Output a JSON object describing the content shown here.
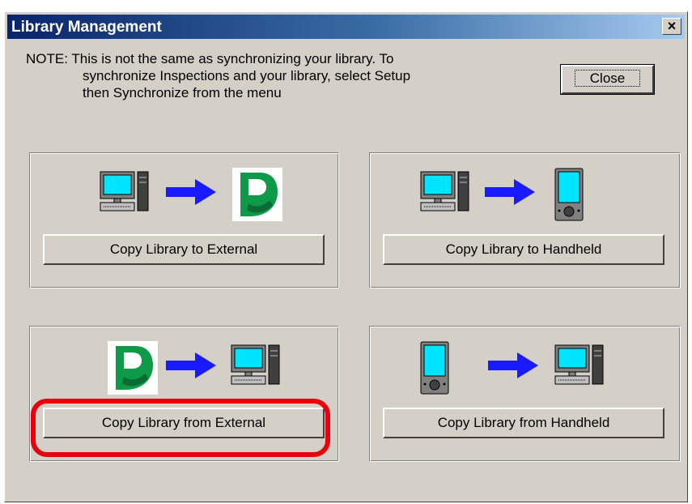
{
  "window": {
    "title": "Library Management",
    "close_glyph": "×"
  },
  "note": {
    "lines": [
      "NOTE: This is not the same as synchronizing your library. To",
      "synchronize Inspections and your library, select Setup",
      "then Synchronize from the menu"
    ]
  },
  "close_button": {
    "label": "Close"
  },
  "panels": [
    {
      "button_label": "Copy Library to External",
      "icons": [
        "computer-icon",
        "arrow-right-icon",
        "external-p-logo-icon"
      ]
    },
    {
      "button_label": "Copy Library to Handheld",
      "icons": [
        "computer-icon",
        "arrow-right-icon",
        "handheld-icon"
      ]
    },
    {
      "button_label": "Copy Library from External",
      "icons": [
        "external-p-logo-icon",
        "arrow-right-icon",
        "computer-icon"
      ],
      "highlighted": true
    },
    {
      "button_label": "Copy Library from Handheld",
      "icons": [
        "handheld-icon",
        "arrow-right-icon",
        "computer-icon"
      ]
    }
  ],
  "colors": {
    "title_gradient_start": "#0a246a",
    "highlight": "#e8000c",
    "arrow": "#1a1aff",
    "logo_green": "#0f9a4a",
    "screen_cyan": "#00e5ff"
  }
}
